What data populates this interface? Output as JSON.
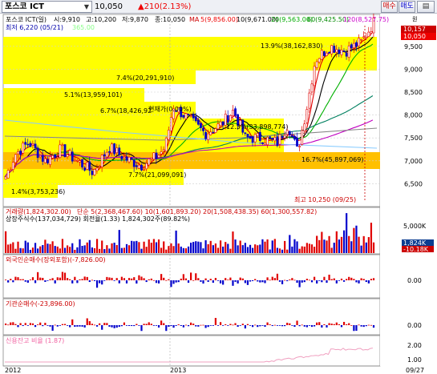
{
  "header": {
    "stock_name": "포스코 ICT",
    "dropdown_glyph": "▼",
    "price": "10,050",
    "change": "▲210(2.13%)",
    "btn_buy": "매수",
    "btn_sell": "매도",
    "btn_settings": "▤"
  },
  "price_panel": {
    "info_name": "포스코 ICT(일)",
    "info_open": "시:9,910",
    "info_high": "고:10,200",
    "info_low": "저:9,870",
    "info_close": "종:10,050",
    "ma_label": "MA",
    "ma5": "5(9,856.00)",
    "ma10": "10(9,671.00)",
    "ma20": "20(9,563.00)",
    "ma60": "60(9,425.50)",
    "ma120": "120(8,527.75)",
    "ma_extra": "365.00",
    "lowest_label": "최저 6,220 (05/21)",
    "highest_label": "최고 10,250 (09/25)",
    "axis_unit": "원",
    "last_price_tag": "10,050",
    "prev_price_tag": "10,157",
    "yaxis": [
      "9,500",
      "9,000",
      "8,500",
      "8,000",
      "7,500",
      "7,000",
      "6,500"
    ],
    "bands": [
      {
        "label": "13.9%(38,162,830)"
      },
      {
        "label": "7.4%(20,291,910)"
      },
      {
        "label": "5.1%(13,959,101)"
      },
      {
        "label": "6.7%(18,426,92",
        "extra": "현재가(0.00%)"
      },
      {
        "label": "12.3%(33,898,774)"
      },
      {
        "label": "16.7%(45,897,069)"
      },
      {
        "label": "7.7%(21,099,091)"
      },
      {
        "label": "1.4%(3,753,236)"
      }
    ],
    "colors": {
      "up": "#e00000",
      "down": "#0000cc",
      "band": "#ffff00",
      "band_strong": "#ffc000"
    }
  },
  "volume_panel": {
    "label_volume": "거래량(1,824,302.00)",
    "label_ma": "단순 5(2,368,467.60)  10(1,601,893.20)  20(1,508,438.35)  60(1,300,557.82)",
    "label_shares": "상장주식수(137,034,729) 회전율(1.33) 1,824,302주(89.82%)",
    "yaxis": "5,000K",
    "tag_value": "1,824K",
    "tag_value2": "-10.18K"
  },
  "foreign_panel": {
    "label": "외국인순매수(장외포함)(-7,826.00)",
    "zero": "0.00"
  },
  "inst_panel": {
    "label": "기관순매수(-23,896.00)",
    "zero": "0.00"
  },
  "credit_panel": {
    "label": "신용잔고 비율 (1.87)",
    "y1": "2.00",
    "y2": "1.00"
  },
  "xaxis": {
    "labels": [
      "2012",
      "2013"
    ],
    "end_label": "09/27"
  }
}
